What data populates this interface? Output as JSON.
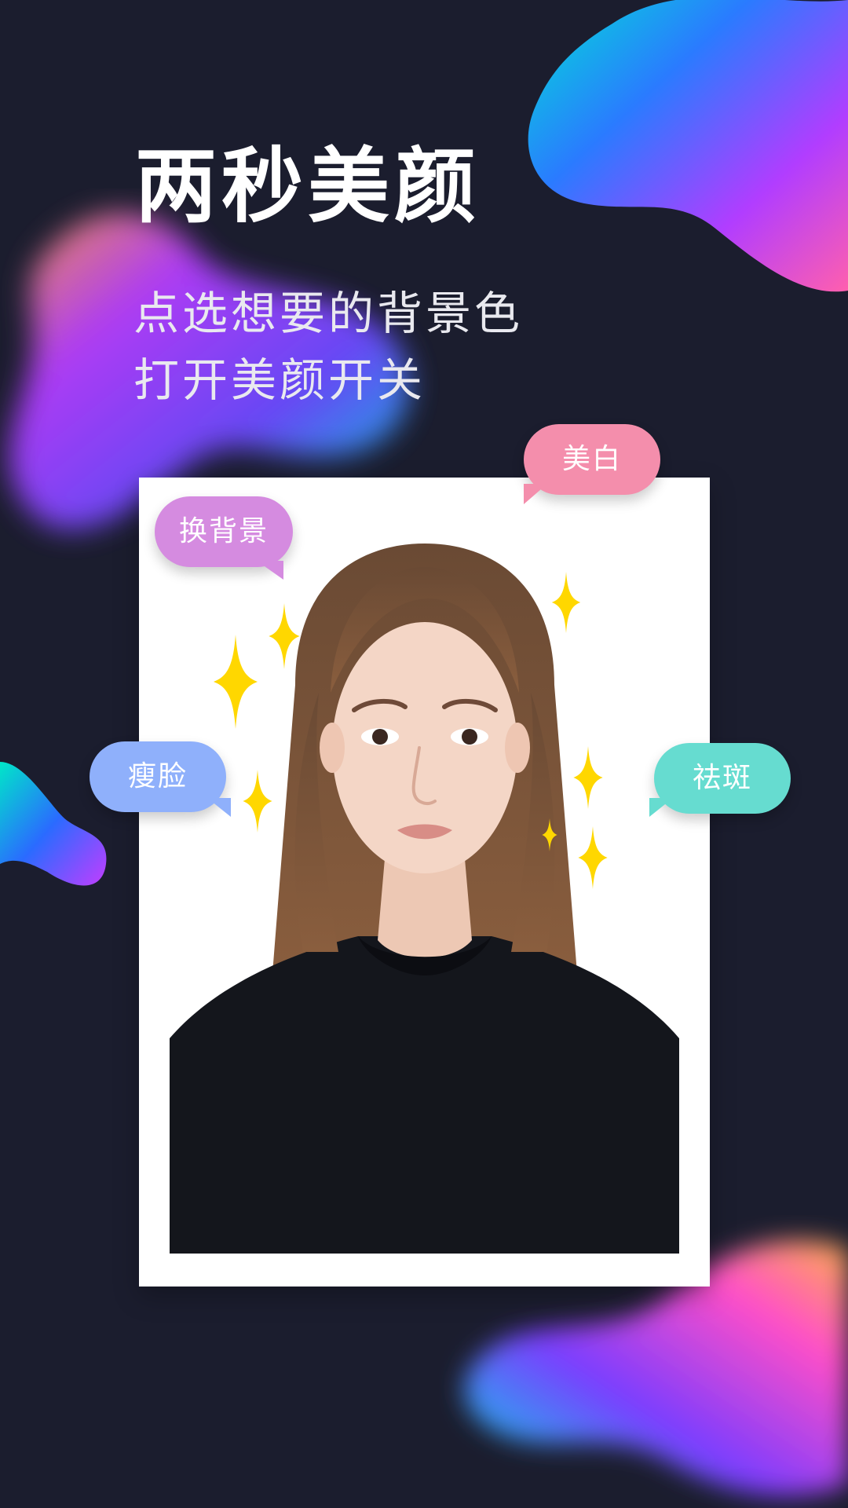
{
  "headline": "两秒美颜",
  "subtitle_lines": [
    "点选想要的背景色",
    "打开美颜开关"
  ],
  "feature_bubbles": {
    "change_background": "换背景",
    "whitening": "美白",
    "slim_face": "瘦脸",
    "spot_removal": "祛斑"
  },
  "colors": {
    "background": "#1b1d2e",
    "bubble_change_background": "#d58be0",
    "bubble_whitening": "#f48eac",
    "bubble_slim_face": "#8fb0fb",
    "bubble_spot_removal": "#66dcd0",
    "sparkle": "#ffd700"
  },
  "icons": [
    "sparkle-icon"
  ]
}
